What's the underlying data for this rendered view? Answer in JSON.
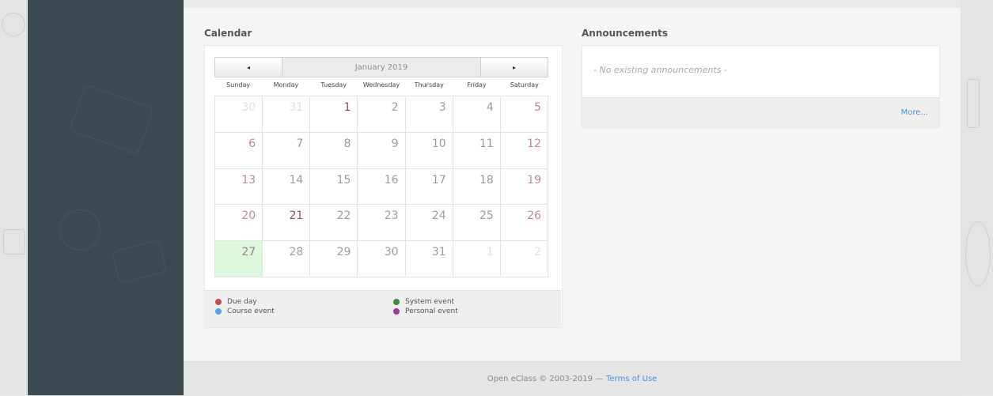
{
  "calendar": {
    "heading": "Calendar",
    "month_title": "January 2019",
    "prev_glyph": "◂",
    "next_glyph": "▸",
    "weekdays": [
      "Sunday",
      "Monday",
      "Tuesday",
      "Wednesday",
      "Thursday",
      "Friday",
      "Saturday"
    ],
    "weeks": [
      [
        {
          "day": "30",
          "type": "other"
        },
        {
          "day": "31",
          "type": "other"
        },
        {
          "day": "1",
          "type": "due"
        },
        {
          "day": "2",
          "type": "normal"
        },
        {
          "day": "3",
          "type": "normal"
        },
        {
          "day": "4",
          "type": "normal"
        },
        {
          "day": "5",
          "type": "weekend"
        }
      ],
      [
        {
          "day": "6",
          "type": "weekend"
        },
        {
          "day": "7",
          "type": "normal"
        },
        {
          "day": "8",
          "type": "normal"
        },
        {
          "day": "9",
          "type": "normal"
        },
        {
          "day": "10",
          "type": "normal"
        },
        {
          "day": "11",
          "type": "normal"
        },
        {
          "day": "12",
          "type": "weekend"
        }
      ],
      [
        {
          "day": "13",
          "type": "weekend"
        },
        {
          "day": "14",
          "type": "normal"
        },
        {
          "day": "15",
          "type": "normal"
        },
        {
          "day": "16",
          "type": "normal"
        },
        {
          "day": "17",
          "type": "normal"
        },
        {
          "day": "18",
          "type": "normal"
        },
        {
          "day": "19",
          "type": "weekend"
        }
      ],
      [
        {
          "day": "20",
          "type": "weekend"
        },
        {
          "day": "21",
          "type": "due"
        },
        {
          "day": "22",
          "type": "normal"
        },
        {
          "day": "23",
          "type": "normal"
        },
        {
          "day": "24",
          "type": "normal"
        },
        {
          "day": "25",
          "type": "normal"
        },
        {
          "day": "26",
          "type": "weekend"
        }
      ],
      [
        {
          "day": "27",
          "type": "today"
        },
        {
          "day": "28",
          "type": "normal"
        },
        {
          "day": "29",
          "type": "normal"
        },
        {
          "day": "30",
          "type": "normal"
        },
        {
          "day": "31",
          "type": "normal"
        },
        {
          "day": "1",
          "type": "other"
        },
        {
          "day": "2",
          "type": "other"
        }
      ]
    ],
    "legend": [
      {
        "label": "Due day",
        "color": "#c0504d"
      },
      {
        "label": "Course event",
        "color": "#5aa3e6"
      },
      {
        "label": "System event",
        "color": "#3c8c3c"
      },
      {
        "label": "Personal event",
        "color": "#9b3c9b"
      }
    ]
  },
  "announcements": {
    "heading": "Announcements",
    "empty_text": "- No existing announcements -",
    "more_label": "More..."
  },
  "footer": {
    "copyright": "Open eClass © 2003-2019 —",
    "terms_label": "Terms of Use"
  },
  "colors": {
    "sidebar": "#3b4a50",
    "link": "#4a90d9",
    "today_highlight": "#ddf7dd"
  }
}
